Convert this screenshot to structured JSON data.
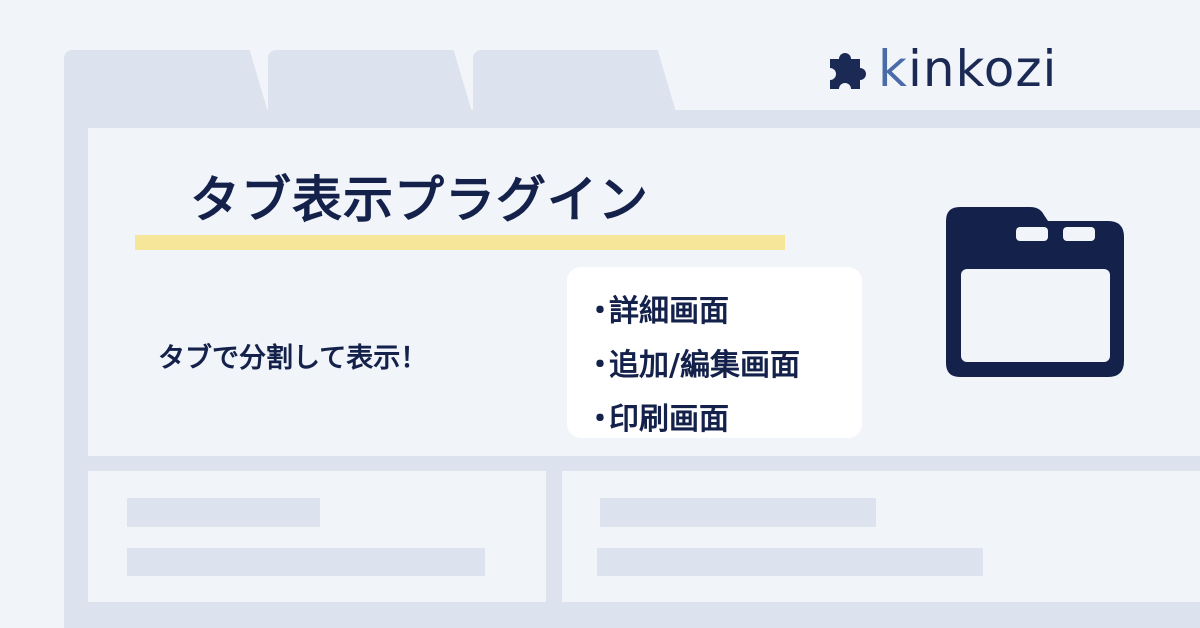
{
  "logo": {
    "text": "kinkozi",
    "icon": "puzzle-piece-icon"
  },
  "title": "タブ表示プラグイン",
  "subtitle": "タブで分割して表示！",
  "features": [
    {
      "bullet": "・",
      "label": "詳細画面"
    },
    {
      "bullet": "・",
      "label": "追加/編集画面"
    },
    {
      "bullet": "・",
      "label": "印刷画面"
    }
  ],
  "main_icon": "browser-window-icon",
  "colors": {
    "navy": "#14214a",
    "background": "#f1f4f9",
    "frame": "#dde3ee",
    "highlight": "#f5e69a",
    "logo_accent": "#4a6aa8"
  }
}
